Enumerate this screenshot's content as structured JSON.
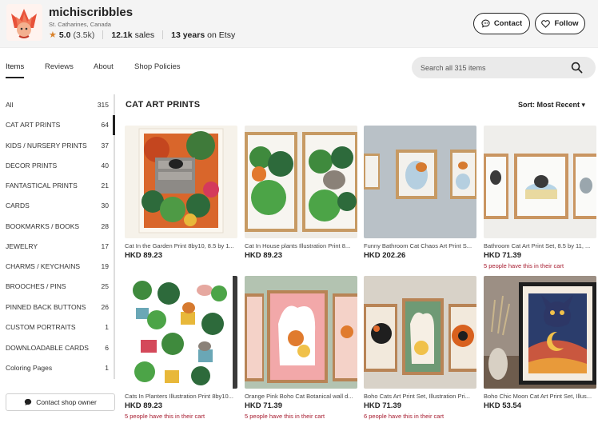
{
  "shop": {
    "name": "michiscribbles",
    "location": "St. Catharines, Canada",
    "rating": "5.0",
    "rating_count": "(3.5k)",
    "sales_count": "12.1k",
    "sales_label": "sales",
    "years": "13 years",
    "years_suffix": "on Etsy",
    "contact_label": "Contact",
    "follow_label": "Follow"
  },
  "tabs": [
    "Items",
    "Reviews",
    "About",
    "Shop Policies"
  ],
  "search": {
    "placeholder": "Search all 315 items"
  },
  "sidebar": {
    "categories": [
      {
        "label": "All",
        "count": "315"
      },
      {
        "label": "CAT ART PRINTS",
        "count": "64"
      },
      {
        "label": "KIDS / NURSERY PRINTS",
        "count": "37"
      },
      {
        "label": "DECOR PRINTS",
        "count": "40"
      },
      {
        "label": "FANTASTICAL PRINTS",
        "count": "21"
      },
      {
        "label": "CARDS",
        "count": "30"
      },
      {
        "label": "BOOKMARKS / BOOKS",
        "count": "28"
      },
      {
        "label": "JEWELRY",
        "count": "17"
      },
      {
        "label": "CHARMS / KEYCHAINS",
        "count": "19"
      },
      {
        "label": "BROOCHES / PINS",
        "count": "25"
      },
      {
        "label": "PINNED BACK BUTTONS",
        "count": "26"
      },
      {
        "label": "CUSTOM PORTRAITS",
        "count": "1"
      },
      {
        "label": "DOWNLOADABLE CARDS",
        "count": "6"
      },
      {
        "label": "Coloring Pages",
        "count": "1"
      }
    ],
    "contact_owner_label": "Contact shop owner"
  },
  "main": {
    "section_title": "CAT ART PRINTS",
    "sort_label": "Sort: Most Recent ▾",
    "products": [
      {
        "title": "Cat In the Garden Print 8by10, 8.5 by 1...",
        "price": "HKD 89.23",
        "cart": ""
      },
      {
        "title": "Cat In House plants Illustration Print 8...",
        "price": "HKD 89.23",
        "cart": ""
      },
      {
        "title": "Funny Bathroom Cat Chaos Art Print S...",
        "price": "HKD 202.26",
        "cart": ""
      },
      {
        "title": "Bathroom Cat Art Print Set, 8.5 by 11, ...",
        "price": "HKD 71.39",
        "cart": "5 people have this in their cart"
      },
      {
        "title": "Cats In Planters Illustration Print 8by10...",
        "price": "HKD 89.23",
        "cart": "5 people have this in their cart"
      },
      {
        "title": "Orange Pink Boho Cat Botanical wall d...",
        "price": "HKD 71.39",
        "cart": "5 people have this in their cart"
      },
      {
        "title": "Boho Cats Art Print Set, Illustration Pri...",
        "price": "HKD 71.39",
        "cart": "6 people have this in their cart"
      },
      {
        "title": "Boho Chic Moon Cat Art Print Set, Illus...",
        "price": "HKD 53.54",
        "cart": ""
      }
    ]
  },
  "colors": {
    "accent_cart": "#a61a2e",
    "star": "#d9822b",
    "header_bg": "#f4f4f4"
  }
}
